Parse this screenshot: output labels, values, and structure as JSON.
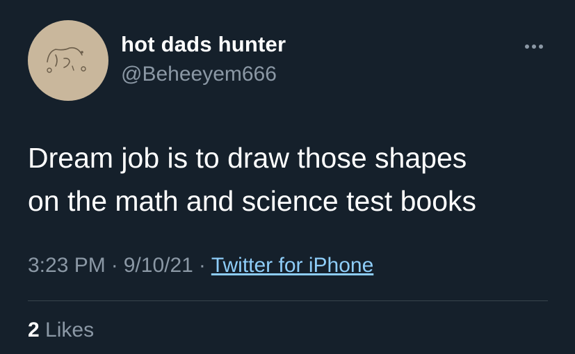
{
  "author": {
    "display_name": "hot dads hunter",
    "handle": "@Beheeyem666",
    "avatar_icon": "doodle-face-avatar"
  },
  "tweet": {
    "lines": [
      "Dream job is to draw those shapes",
      "on the math and science test books"
    ]
  },
  "meta": {
    "time": "3:23 PM",
    "separator": "·",
    "date": "9/10/21",
    "source": "Twitter for iPhone"
  },
  "engagement": {
    "likes_count": "2",
    "likes_label": "Likes"
  },
  "menu": {
    "icon": "more-options-icon"
  },
  "colors": {
    "background": "#15202b",
    "primary_text": "#ffffff",
    "secondary_text": "#8b98a5",
    "link": "#8ecdf8",
    "divider": "#38444d",
    "avatar_bg": "#c9b79c"
  }
}
